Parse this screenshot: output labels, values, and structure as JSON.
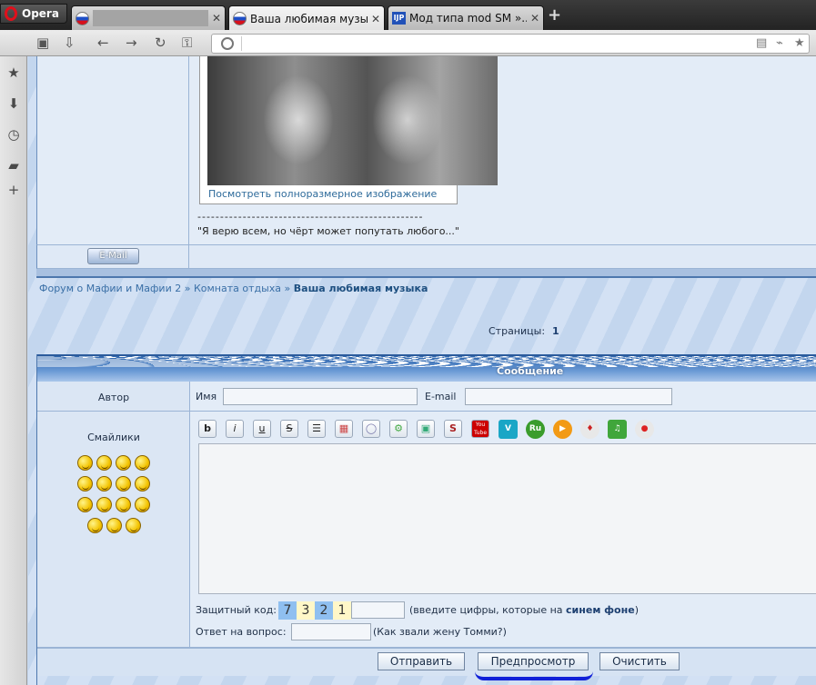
{
  "browser": {
    "opera_label": "Opera",
    "tabs": [
      {
        "title": ""
      },
      {
        "title": "Ваша любимая музы..."
      },
      {
        "title": "Мод типа mod SM »..."
      }
    ],
    "close_glyph": "✕",
    "new_tab_glyph": "+",
    "url": ""
  },
  "post": {
    "full_view_link": "Посмотреть полноразмерное изображение",
    "separator": "--------------------------------------------------",
    "quote": "\"Я верю всем, но чёрт может попутать любого...\"",
    "email_button": "E-Mail"
  },
  "breadcrumb": {
    "forum": "Форум о Мафии и Мафии 2",
    "sep1": " » ",
    "section": "Комната отдыха",
    "sep2": " » ",
    "topic": "Ваша любимая музыка"
  },
  "pagination": {
    "label": "Страницы:",
    "current": "1"
  },
  "reply_form": {
    "header": "Сообщение",
    "author_label": "Автор",
    "name_label": "Имя",
    "name_value": "",
    "email_label": "E-mail",
    "email_value": "",
    "smileys_label": "Смайлики",
    "smileys_count": 15,
    "editor_buttons": [
      "b",
      "i",
      "u",
      "S",
      "☰",
      "▦",
      "◯",
      "⚙",
      "▣",
      "S",
      "You Tube",
      "V",
      "Ru",
      "▶",
      "♦",
      "♫",
      "●"
    ],
    "message_text": "",
    "captcha_label": "Защитный код:",
    "captcha_digits": [
      "7",
      "3",
      "2",
      "1"
    ],
    "captcha_value": "",
    "captcha_hint_pre": "(введите цифры, которые на ",
    "captcha_hint_bold": "синем фоне",
    "captcha_hint_post": ")",
    "answer_label": "Ответ на вопрос:",
    "answer_value": "",
    "question": "(Как звали жену Томми?)",
    "buttons": {
      "send": "Отправить",
      "preview": "Предпросмотр",
      "clear": "Очистить"
    }
  }
}
